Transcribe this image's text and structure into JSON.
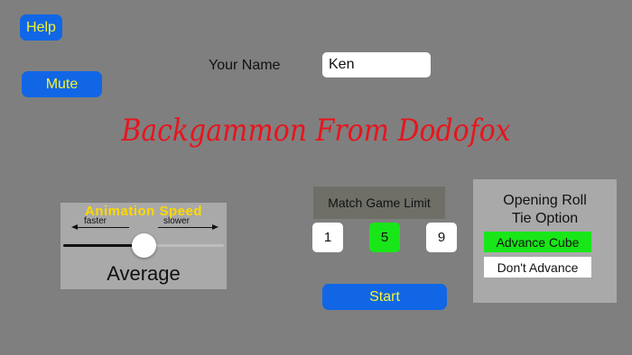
{
  "buttons": {
    "help": "Help",
    "mute": "Mute",
    "start": "Start"
  },
  "player": {
    "name_label": "Your Name",
    "name_value": "Ken"
  },
  "title": "Backgammon From Dodofox",
  "animation": {
    "title": "Animation Speed",
    "faster": "faster",
    "slower": "slower",
    "level": 0.5,
    "value_label": "Average"
  },
  "match": {
    "label": "Match Game Limit",
    "options": [
      "1",
      "5",
      "9"
    ],
    "selected": "5"
  },
  "tie": {
    "title_line1": "Opening Roll",
    "title_line2": "Tie Option",
    "advance": "Advance Cube",
    "dont_advance": "Don't Advance",
    "selected": "Advance Cube"
  },
  "colors": {
    "background": "#7f7f7f",
    "button_blue": "#1166e6",
    "button_text": "#f4f430",
    "title_red": "#e8141c",
    "selected_green": "#19e619",
    "panel_gray": "#a9a9a9",
    "anim_title_yellow": "#ffd800"
  }
}
